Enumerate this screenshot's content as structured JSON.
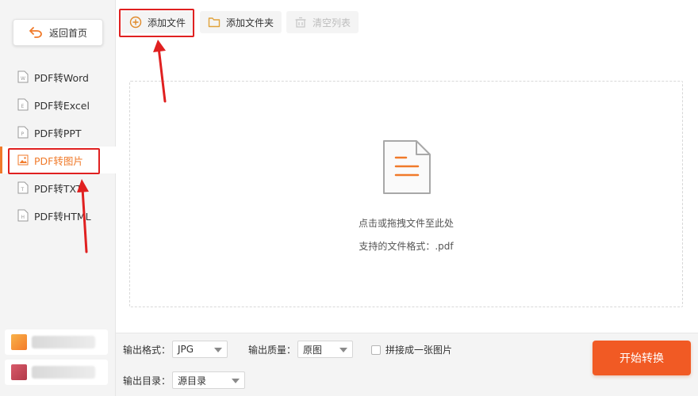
{
  "sidebar": {
    "back_label": "返回首页",
    "items": [
      {
        "label": "PDF转Word",
        "badge": "W"
      },
      {
        "label": "PDF转Excel",
        "badge": "E"
      },
      {
        "label": "PDF转PPT",
        "badge": "P"
      },
      {
        "label": "PDF转图片",
        "badge": "img",
        "active": true
      },
      {
        "label": "PDF转TXT",
        "badge": "T"
      },
      {
        "label": "PDF转HTML",
        "badge": "H"
      }
    ]
  },
  "toolbar": {
    "add_file": "添加文件",
    "add_folder": "添加文件夹",
    "clear_list": "清空列表"
  },
  "dropzone": {
    "hint": "点击或拖拽文件至此处",
    "formats": "支持的文件格式：.pdf"
  },
  "bottom": {
    "format_label": "输出格式：",
    "format_value": "JPG",
    "quality_label": "输出质量：",
    "quality_value": "原图",
    "merge_label": "拼接成一张图片",
    "merge_checked": false,
    "dir_label": "输出目录：",
    "dir_value": "源目录",
    "start_label": "开始转换"
  },
  "colors": {
    "accent": "#f07a2a",
    "start_button": "#f15a24",
    "annotation": "#e02020"
  },
  "icons": [
    "back-arrow-icon",
    "plus-circle-icon",
    "folder-icon",
    "clear-list-icon",
    "document-icon",
    "file-icon",
    "image-icon"
  ]
}
